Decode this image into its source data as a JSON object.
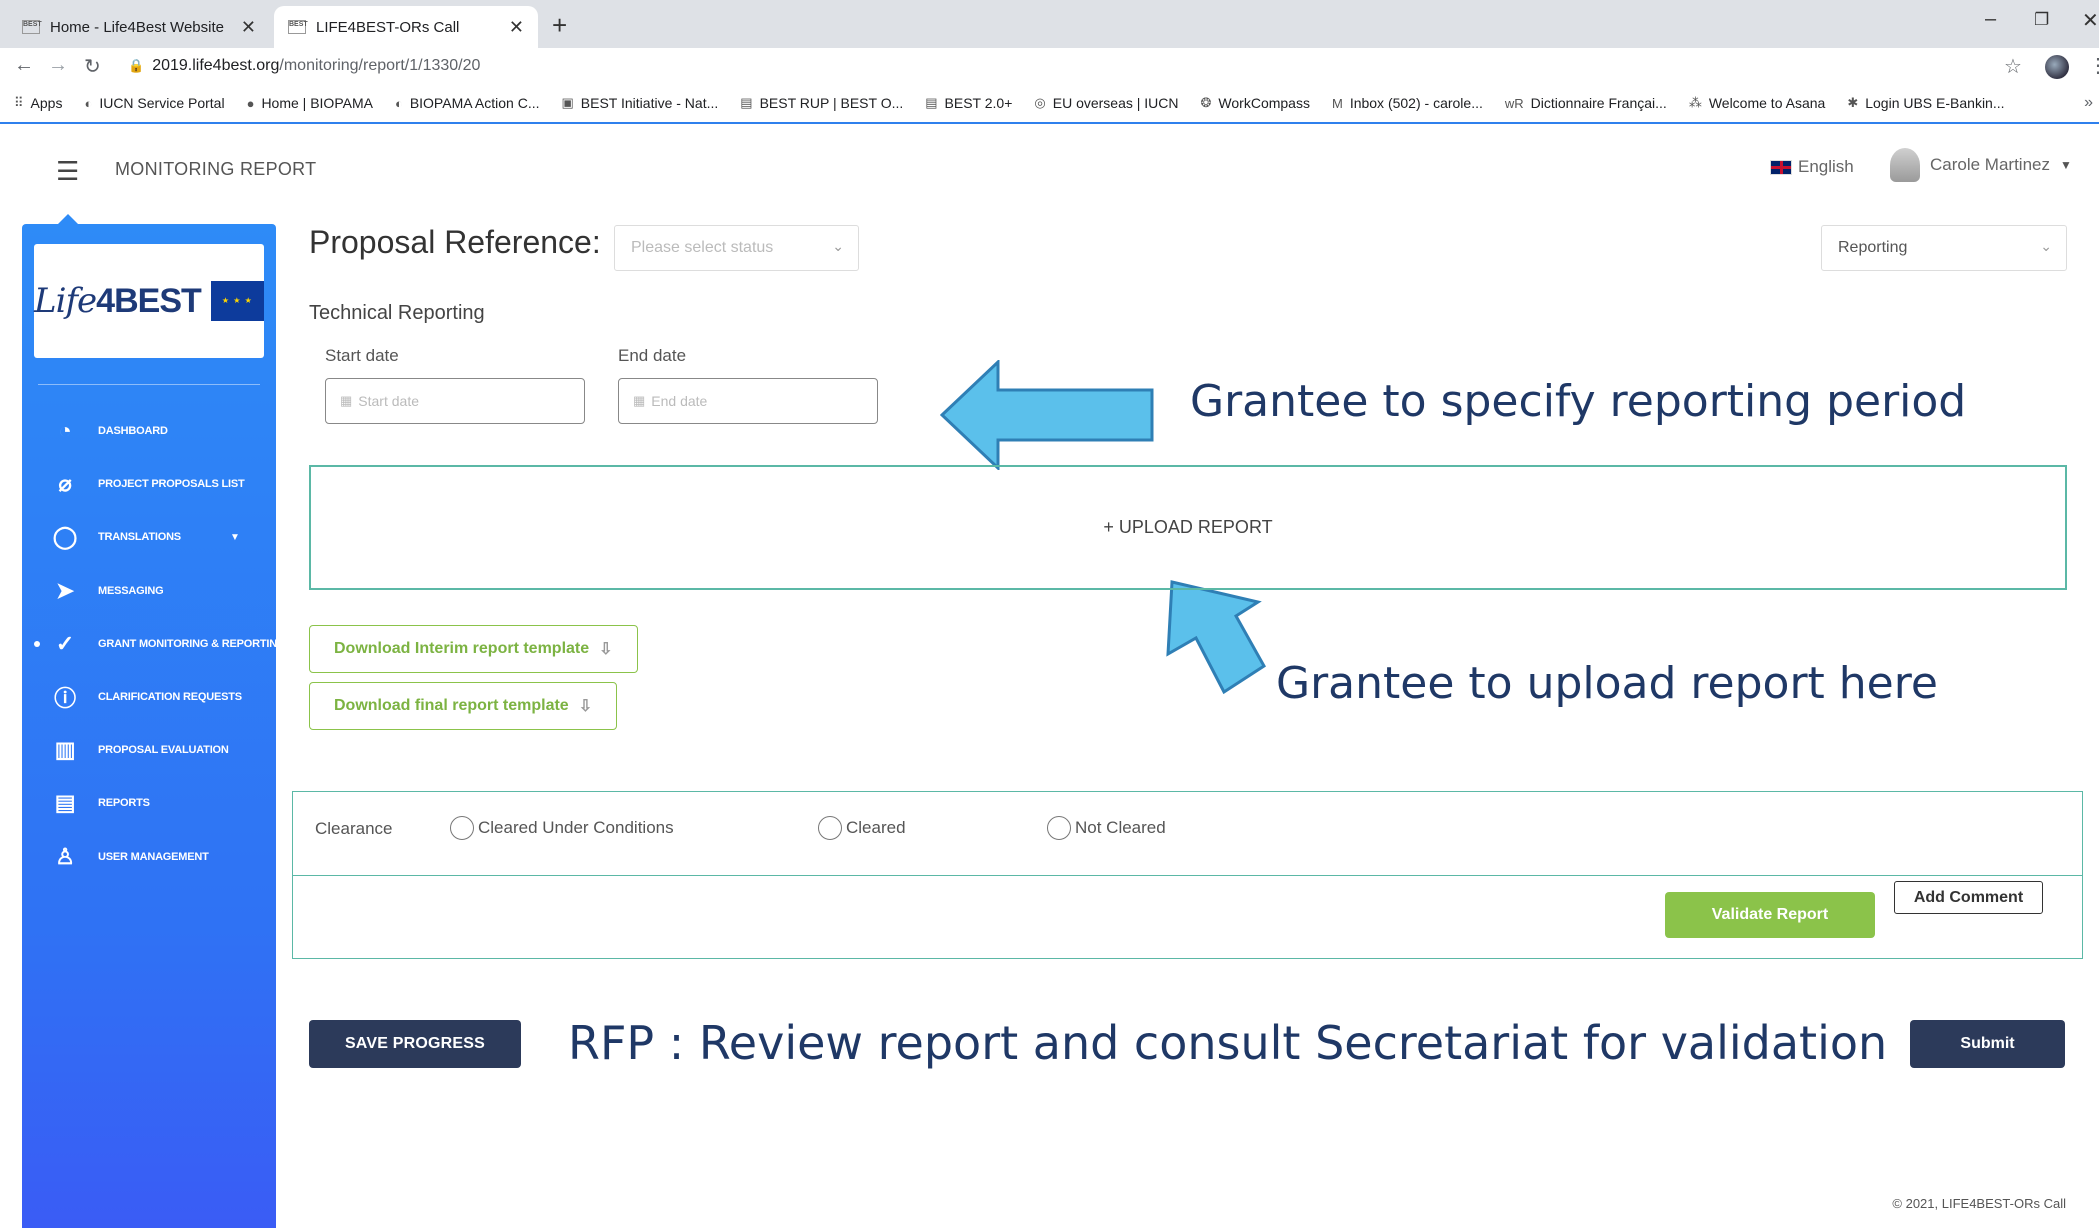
{
  "browser": {
    "tabs": [
      {
        "favicon": "BEST",
        "title": "Home - Life4Best Website",
        "close": "✕"
      },
      {
        "favicon": "BEST",
        "title": "LIFE4BEST-ORs Call",
        "close": "✕"
      }
    ],
    "new_tab": "+",
    "window_controls": {
      "minimize": "–",
      "restore": "❐",
      "close": "✕"
    },
    "address": {
      "host": "2019.life4best.org",
      "path": "/monitoring/report/1/1330/20"
    },
    "bookmarks": [
      {
        "icon": "⠿",
        "label": "Apps"
      },
      {
        "icon": "◐",
        "label": "IUCN Service Portal"
      },
      {
        "icon": "●",
        "label": "Home | BIOPAMA"
      },
      {
        "icon": "◐",
        "label": "BIOPAMA Action C..."
      },
      {
        "icon": "▣",
        "label": "BEST Initiative - Nat..."
      },
      {
        "icon": "▤",
        "label": "BEST RUP | BEST O..."
      },
      {
        "icon": "▤",
        "label": "BEST 2.0+"
      },
      {
        "icon": "◎",
        "label": "EU overseas | IUCN"
      },
      {
        "icon": "❂",
        "label": "WorkCompass"
      },
      {
        "icon": "M",
        "label": "Inbox (502) - carole..."
      },
      {
        "icon": "wR",
        "label": "Dictionnaire Françai..."
      },
      {
        "icon": "⁂",
        "label": "Welcome to Asana"
      },
      {
        "icon": "✱",
        "label": "Login UBS E-Bankin..."
      }
    ],
    "bookmarks_more": "»"
  },
  "header": {
    "title": "MONITORING REPORT",
    "language": "English",
    "user_name": "Carole Martinez"
  },
  "sidebar": {
    "logo_text_a": "Life",
    "logo_text_b": "4BEST",
    "items": [
      {
        "label": "DASHBOARD",
        "icon": "◔"
      },
      {
        "label": "PROJECT PROPOSALS LIST",
        "icon": "⌀"
      },
      {
        "label": "TRANSLATIONS",
        "icon": "◯"
      },
      {
        "label": "MESSAGING",
        "icon": "➤"
      },
      {
        "label": "GRANT MONITORING & REPORTING",
        "icon": "✓"
      },
      {
        "label": "CLARIFICATION REQUESTS",
        "icon": "ⓘ"
      },
      {
        "label": "PROPOSAL EVALUATION",
        "icon": "▥"
      },
      {
        "label": "REPORTS",
        "icon": "▤"
      },
      {
        "label": "USER MANAGEMENT",
        "icon": "♙"
      }
    ]
  },
  "main": {
    "proposal_label": "Proposal Reference:",
    "status_placeholder": "Please select status",
    "reporting_value": "Reporting",
    "technical_title": "Technical Reporting",
    "start_label": "Start date",
    "start_placeholder": "Start date",
    "end_label": "End date",
    "end_placeholder": "End date",
    "upload_label": "+ UPLOAD REPORT",
    "download_interim": "Download Interim report template",
    "download_final": "Download final report template",
    "clearance_label": "Clearance",
    "radio_options": [
      "Cleared Under Conditions",
      "Cleared",
      "Not Cleared"
    ],
    "validate_label": "Validate Report",
    "comment_label": "Add Comment",
    "save_label": "SAVE PROGRESS",
    "submit_label": "Submit"
  },
  "annotations": {
    "period": "Grantee to specify reporting period",
    "upload": "Grantee to upload report here",
    "review": "RFP : Review report and consult Secretariat for validation"
  },
  "footer": {
    "copyright": "© 2021, LIFE4BEST-ORs Call"
  },
  "colors": {
    "sidebar_top": "#2e8bf7",
    "sidebar_bottom": "#3a5cf5",
    "accent_green": "#8bc34a",
    "teal_border": "#5bb8a6",
    "dark_button": "#2c3a5a",
    "annotation_text": "#1f3866",
    "arrow_fill": "#5bc0eb"
  }
}
